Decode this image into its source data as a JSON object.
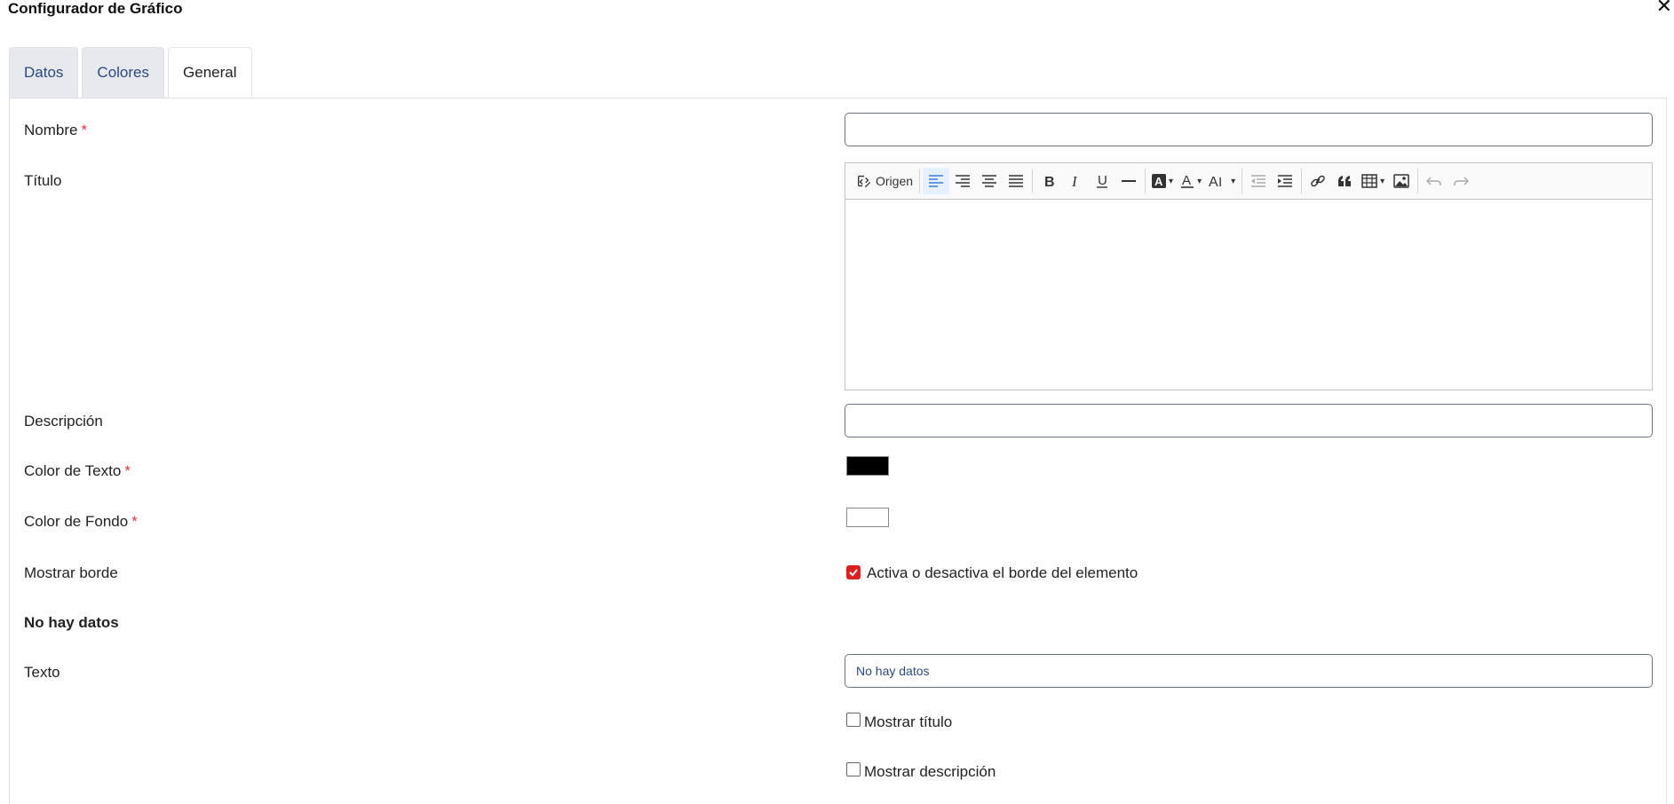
{
  "dialog": {
    "title": "Configurador de Gráfico"
  },
  "tabs": [
    {
      "label": "Datos"
    },
    {
      "label": "Colores"
    },
    {
      "label": "General"
    }
  ],
  "form": {
    "nombre": {
      "label": "Nombre",
      "required_mark": "*",
      "value": ""
    },
    "titulo": {
      "label": "Título",
      "toolbar": {
        "source_label": "Origen"
      }
    },
    "descripcion": {
      "label": "Descripción",
      "value": ""
    },
    "color_texto": {
      "label": "Color de Texto",
      "required_mark": "*",
      "value": "#000000"
    },
    "color_fondo": {
      "label": "Color de Fondo",
      "required_mark": "*",
      "value": "#ffffff"
    },
    "mostrar_borde": {
      "label": "Mostrar borde",
      "checkbox_label": "Activa o desactiva el borde del elemento",
      "checked": true
    },
    "no_data_section": {
      "heading": "No hay datos"
    },
    "texto": {
      "label": "Texto",
      "value": "No hay datos"
    },
    "mostrar_titulo": {
      "label": "Mostrar título",
      "checked": false
    },
    "mostrar_descripcion": {
      "label": "Mostrar descripción",
      "checked": false
    }
  },
  "colors": {
    "tab_text": "#2c4a7d",
    "required": "#dc3545",
    "checkbox_checked": "#dc1f1f"
  }
}
